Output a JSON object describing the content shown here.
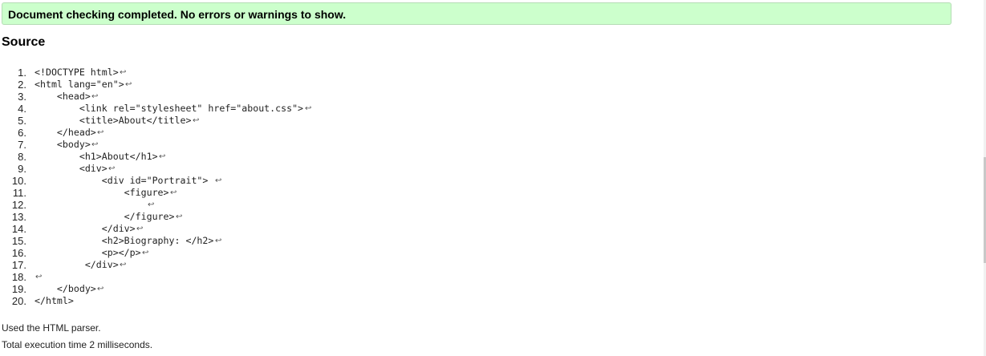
{
  "status": {
    "message": "Document checking completed. No errors or warnings to show."
  },
  "source": {
    "heading": "Source",
    "line_end_glyph": "↩",
    "lines": [
      {
        "num": "1.",
        "code": "<!DOCTYPE html>",
        "end": true
      },
      {
        "num": "2.",
        "code": "<html lang=\"en\">",
        "end": true
      },
      {
        "num": "3.",
        "code": "    <head>",
        "end": true
      },
      {
        "num": "4.",
        "code": "        <link rel=\"stylesheet\" href=\"about.css\">",
        "end": true
      },
      {
        "num": "5.",
        "code": "        <title>About</title>",
        "end": true
      },
      {
        "num": "6.",
        "code": "    </head>",
        "end": true
      },
      {
        "num": "7.",
        "code": "    <body>",
        "end": true
      },
      {
        "num": "8.",
        "code": "        <h1>About</h1>",
        "end": true
      },
      {
        "num": "9.",
        "code": "        <div>",
        "end": true
      },
      {
        "num": "10.",
        "code": "            <div id=\"Portrait\"> ",
        "end": true
      },
      {
        "num": "11.",
        "code": "                <figure>",
        "end": true
      },
      {
        "num": "12.",
        "code": "                    ",
        "end": true
      },
      {
        "num": "13.",
        "code": "                </figure>",
        "end": true
      },
      {
        "num": "14.",
        "code": "            </div>",
        "end": true
      },
      {
        "num": "15.",
        "code": "            <h2>Biography: </h2>",
        "end": true
      },
      {
        "num": "16.",
        "code": "            <p></p>",
        "end": true
      },
      {
        "num": "17.",
        "code": "         </div>",
        "end": true
      },
      {
        "num": "18.",
        "code": "",
        "end": true
      },
      {
        "num": "19.",
        "code": "    </body>",
        "end": true
      },
      {
        "num": "20.",
        "code": "</html>",
        "end": false
      }
    ]
  },
  "footer": {
    "parser": "Used the HTML parser.",
    "execution_time": "Total execution time 2 milliseconds."
  }
}
